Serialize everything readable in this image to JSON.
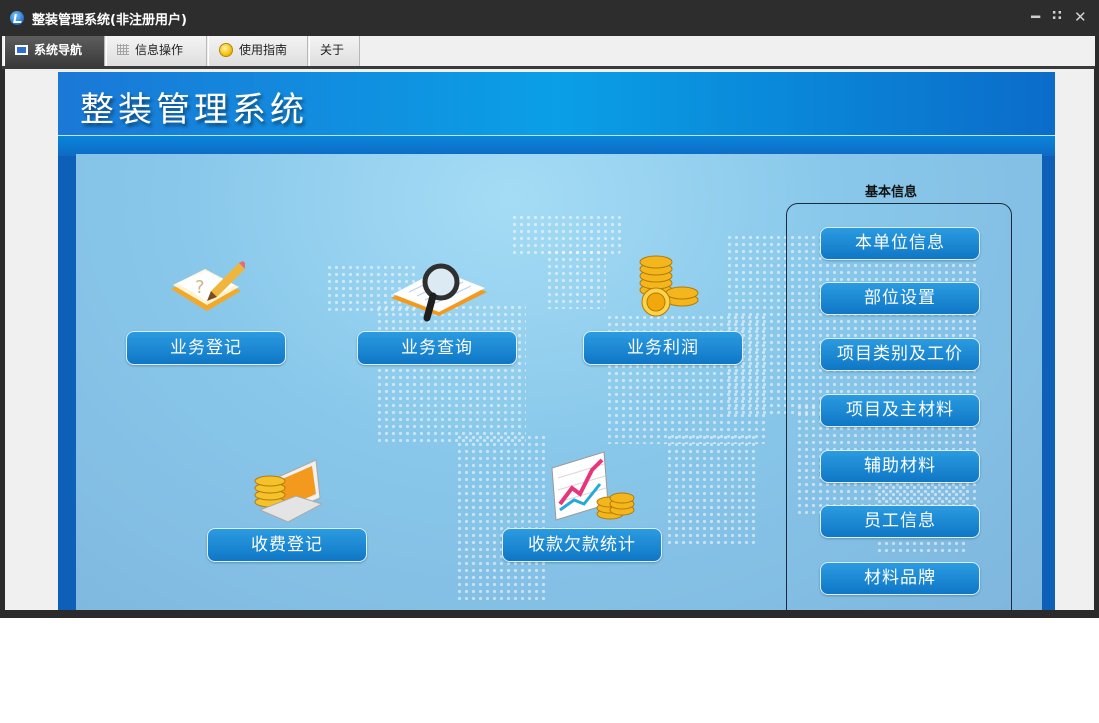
{
  "window": {
    "title": "整装管理系统(非注册用户)",
    "controls": [
      "minimize-icon",
      "restore-icon",
      "close-icon"
    ]
  },
  "tabs": [
    {
      "label": "系统导航",
      "icon": "monitor-icon",
      "active": true
    },
    {
      "label": "信息操作",
      "icon": "grid-icon",
      "active": false
    },
    {
      "label": "使用指南",
      "icon": "smiley-icon",
      "active": false
    },
    {
      "label": "关于",
      "icon": "",
      "active": false
    }
  ],
  "main": {
    "system_title": "整装管理系统",
    "functions": [
      {
        "label": "业务登记",
        "icon": "notebook-pencil-icon"
      },
      {
        "label": "业务查询",
        "icon": "magnifier-document-icon"
      },
      {
        "label": "业务利润",
        "icon": "gold-coins-icon"
      },
      {
        "label": "收费登记",
        "icon": "coins-laptop-icon"
      },
      {
        "label": "收款欠款统计",
        "icon": "chart-coins-icon"
      }
    ],
    "basic_info": {
      "title": "基本信息",
      "items": [
        "本单位信息",
        "部位设置",
        "项目类别及工价",
        "项目及主材料",
        "辅助材料",
        "员工信息",
        "材料品牌"
      ]
    }
  },
  "colors": {
    "titlebar": "#2d2d2d",
    "header_blue": "#0a9fe6",
    "panel_blue": "#88c7ea",
    "button_blue": "#1a86d2"
  }
}
